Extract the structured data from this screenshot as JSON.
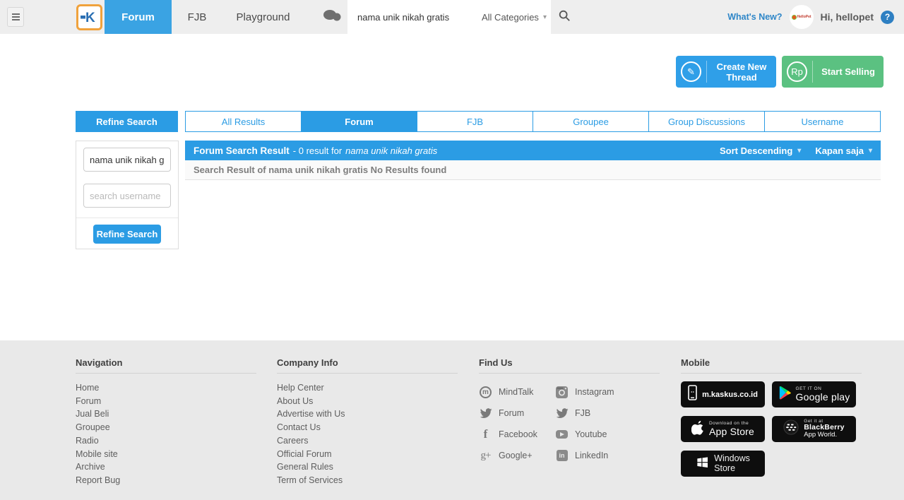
{
  "header": {
    "nav": {
      "forum": "Forum",
      "fjb": "FJB",
      "playground": "Playground"
    },
    "search": {
      "value": "nama unik nikah gratis",
      "category": "All Categories"
    },
    "whats_new": "What's New?",
    "greeting": "Hi, hellopet"
  },
  "actions": {
    "create_thread": "Create New Thread",
    "start_selling": "Start Selling",
    "rp": "Rp"
  },
  "refine": {
    "toggle": "Refine Search",
    "keyword_value": "nama unik nikah g",
    "username_placeholder": "search username",
    "submit": "Refine Search"
  },
  "tabs": {
    "items": [
      "All Results",
      "Forum",
      "FJB",
      "Groupee",
      "Group Discussions",
      "Username"
    ],
    "active": "Forum"
  },
  "results": {
    "title": "Forum Search Result",
    "count_text": "- 0 result for",
    "query": "nama unik nikah gratis",
    "sort": "Sort Descending",
    "period": "Kapan saja",
    "empty": "Search Result of nama unik nikah gratis No Results found"
  },
  "footer": {
    "navigation": {
      "heading": "Navigation",
      "links": [
        "Home",
        "Forum",
        "Jual Beli",
        "Groupee",
        "Radio",
        "Mobile site",
        "Archive",
        "Report Bug"
      ]
    },
    "company": {
      "heading": "Company Info",
      "links": [
        "Help Center",
        "About Us",
        "Advertise with Us",
        "Contact Us",
        "Careers",
        "Official Forum",
        "General Rules",
        "Term of Services"
      ]
    },
    "find_us": {
      "heading": "Find Us",
      "items": [
        {
          "icon": "mindtalk-icon",
          "label": "MindTalk"
        },
        {
          "icon": "instagram-icon",
          "label": "Instagram"
        },
        {
          "icon": "twitter-icon",
          "label": "Forum"
        },
        {
          "icon": "twitter-icon",
          "label": "FJB"
        },
        {
          "icon": "facebook-icon",
          "label": "Facebook"
        },
        {
          "icon": "youtube-icon",
          "label": "Youtube"
        },
        {
          "icon": "googleplus-icon",
          "label": "Google+"
        },
        {
          "icon": "linkedin-icon",
          "label": "LinkedIn"
        }
      ]
    },
    "mobile": {
      "heading": "Mobile",
      "badges": [
        {
          "main": "m.kaskus.co.id"
        },
        {
          "top": "GET IT ON",
          "main": "Google play"
        },
        {
          "top": "Download on the",
          "main": "App Store"
        },
        {
          "top": "Get it at",
          "main": "BlackBerry",
          "sub": "App World."
        },
        {
          "main": "Windows",
          "sub": "Store"
        }
      ]
    }
  },
  "colors": {
    "primary": "#2b9ce4",
    "green": "#5bc181",
    "orange": "#f0a23c",
    "header_bg": "#eeeeee",
    "footer_bg": "#e9e9e9"
  }
}
